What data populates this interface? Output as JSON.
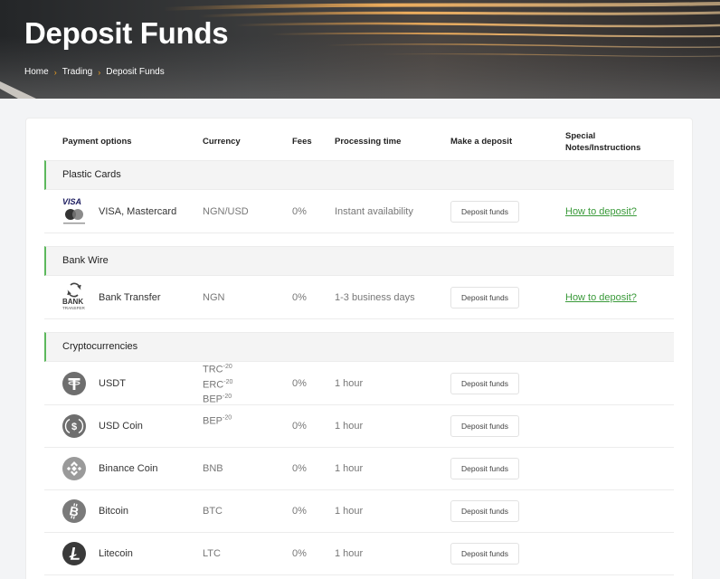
{
  "hero": {
    "title": "Deposit Funds",
    "breadcrumb": [
      "Home",
      "Trading",
      "Deposit Funds"
    ]
  },
  "table": {
    "headers": {
      "payment": "Payment options",
      "currency": "Currency",
      "fees": "Fees",
      "processing": "Processing time",
      "deposit": "Make a deposit",
      "notes_line1": "Special",
      "notes_line2": "Notes/Instructions"
    },
    "groups": {
      "cards": "Plastic Cards",
      "wire": "Bank Wire",
      "crypto": "Cryptocurrencies"
    },
    "rows": [
      {
        "icon": "visa-mastercard-icon",
        "icon_text": "VISA",
        "name": "VISA, Mastercard",
        "currency": "NGN/USD",
        "fee": "0%",
        "time": "Instant availability",
        "button": "Deposit funds",
        "link": "How to deposit?"
      },
      {
        "icon": "bank-transfer-icon",
        "icon_text": "BANK",
        "icon_subtext": "TRANSFER",
        "name": "Bank Transfer",
        "currency": "NGN",
        "fee": "0%",
        "time": "1-3 business days",
        "button": "Deposit funds",
        "link": "How to deposit?"
      },
      {
        "icon": "tether-icon",
        "name": "USDT",
        "currency_lines": [
          {
            "base": "TRC",
            "sup": "-20"
          },
          {
            "base": "ERC",
            "sup": "-20"
          },
          {
            "base": "BEP",
            "sup": "-20"
          }
        ],
        "fee": "0%",
        "time": "1 hour",
        "button": "Deposit funds"
      },
      {
        "icon": "usd-coin-icon",
        "name": "USD Coin",
        "currency_lines": [
          {
            "base": "BEP",
            "sup": "-20"
          }
        ],
        "fee": "0%",
        "time": "1 hour",
        "button": "Deposit funds"
      },
      {
        "icon": "binance-coin-icon",
        "name": "Binance Coin",
        "currency": "BNB",
        "fee": "0%",
        "time": "1 hour",
        "button": "Deposit funds"
      },
      {
        "icon": "bitcoin-icon",
        "name": "Bitcoin",
        "currency": "BTC",
        "fee": "0%",
        "time": "1 hour",
        "button": "Deposit funds"
      },
      {
        "icon": "litecoin-icon",
        "name": "Litecoin",
        "currency": "LTC",
        "fee": "0%",
        "time": "1 hour",
        "button": "Deposit funds"
      }
    ]
  },
  "colors": {
    "accent_green": "#5cb85c",
    "link_green": "#3a9a3a",
    "breadcrumb_sep": "#f0a020",
    "icon_grey": "#6e6e6e"
  }
}
